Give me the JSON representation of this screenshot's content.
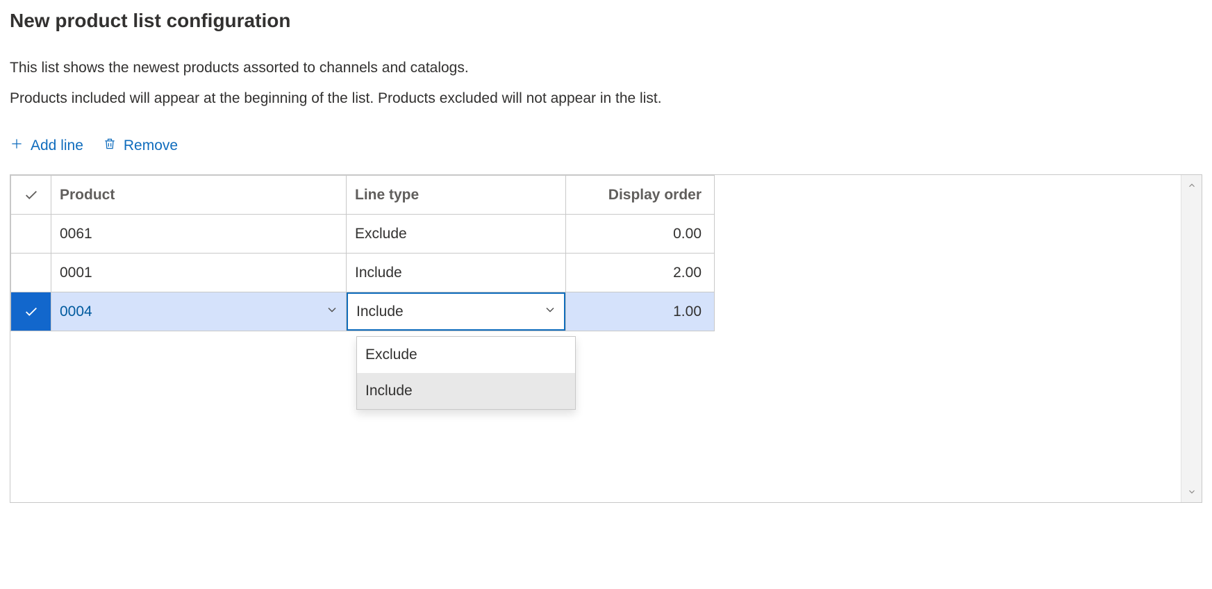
{
  "title": "New product list configuration",
  "description_line1": "This list shows the newest products assorted to channels and catalogs.",
  "description_line2": "Products included will appear at the beginning of the list. Products excluded will not appear in the list.",
  "toolbar": {
    "add_line_label": "Add line",
    "remove_label": "Remove"
  },
  "columns": {
    "product": "Product",
    "line_type": "Line type",
    "display_order": "Display order"
  },
  "rows": [
    {
      "product": "0061",
      "line_type": "Exclude",
      "display_order": "0.00",
      "selected": false
    },
    {
      "product": "0001",
      "line_type": "Include",
      "display_order": "2.00",
      "selected": false
    },
    {
      "product": "0004",
      "line_type": "Include",
      "display_order": "1.00",
      "selected": true
    }
  ],
  "line_type_options": [
    "Exclude",
    "Include"
  ],
  "dropdown_highlight": "Include"
}
